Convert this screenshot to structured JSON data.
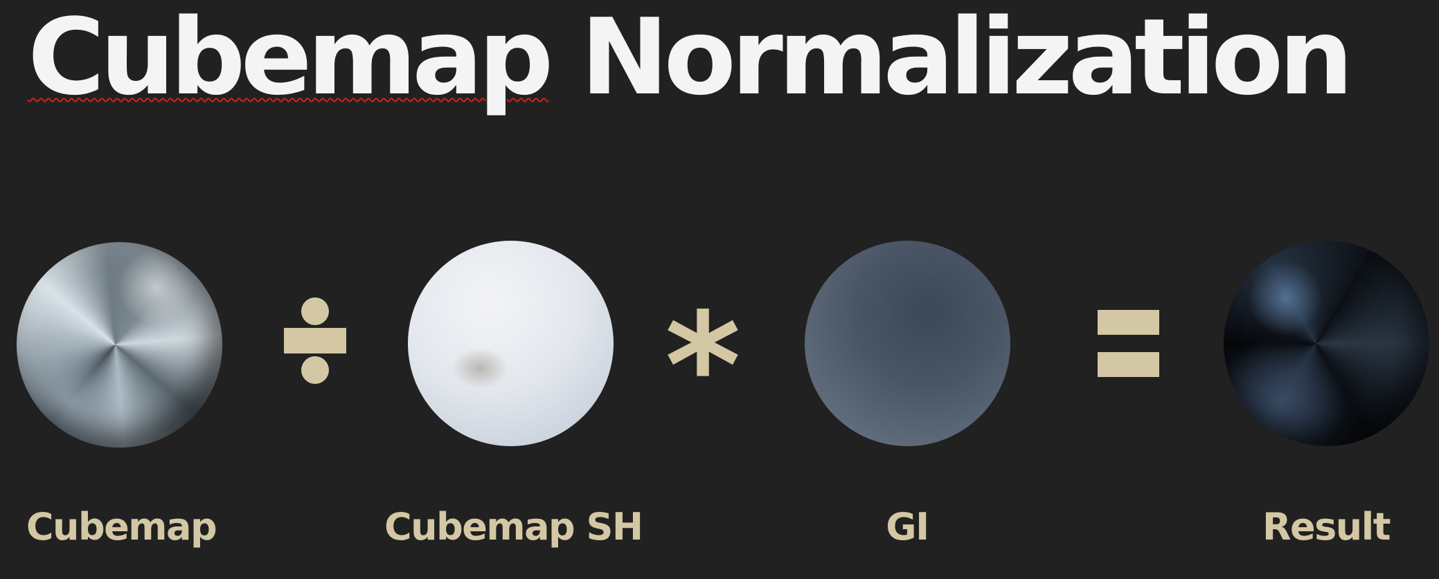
{
  "slide": {
    "title_word1": "Cubemap",
    "title_word2": "Normalization"
  },
  "equation": {
    "items": [
      {
        "label": "Cubemap"
      },
      {
        "operator": "÷"
      },
      {
        "label": "Cubemap SH"
      },
      {
        "operator": "*"
      },
      {
        "label": "GI"
      },
      {
        "operator": "="
      },
      {
        "label": "Result"
      }
    ]
  },
  "colors": {
    "background": "#212121",
    "title": "#f4f4f4",
    "accent": "#d4c7a4"
  }
}
